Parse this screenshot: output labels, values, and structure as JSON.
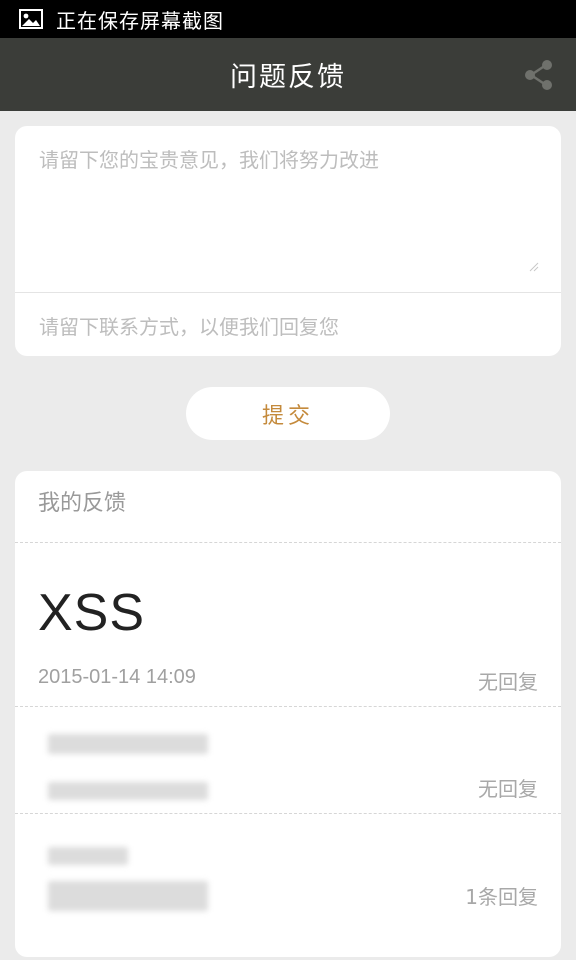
{
  "status_bar": {
    "text": "正在保存屏幕截图",
    "icon": "image-icon"
  },
  "header": {
    "title": "问题反馈",
    "share_icon": "share-icon"
  },
  "form": {
    "feedback_placeholder": "请留下您的宝贵意见，我们将努力改进",
    "contact_placeholder": "请留下联系方式，以便我们回复您",
    "submit_label": "提交"
  },
  "list": {
    "title": "我的反馈",
    "items": [
      {
        "title": "XSS",
        "time": "2015-01-14 14:09",
        "reply_status": "无回复"
      },
      {
        "title": "",
        "time": "",
        "reply_status": "无回复"
      },
      {
        "title": "",
        "time": "",
        "reply_status": "1条回复"
      }
    ]
  },
  "colors": {
    "accent": "#c48a3c",
    "header_bg": "#3b3d39",
    "page_bg": "#ebebeb"
  }
}
